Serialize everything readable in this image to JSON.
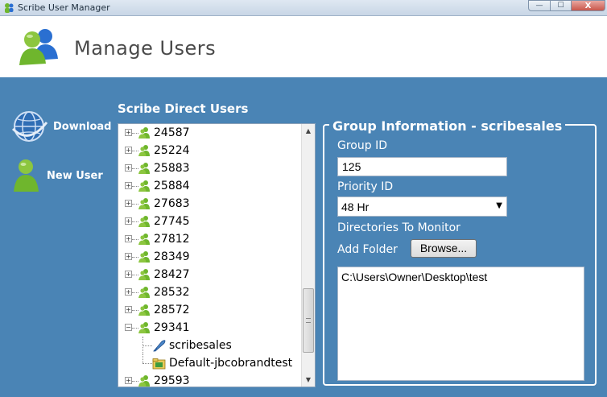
{
  "window": {
    "title": "Scribe User Manager",
    "controls": {
      "minimize": "—",
      "maximize": "☐",
      "close": "X"
    }
  },
  "header": {
    "title": "Manage Users"
  },
  "sidebar": {
    "download_label": "Download",
    "new_user_label": "New User"
  },
  "tree": {
    "heading": "Scribe Direct Users",
    "nodes": [
      {
        "label": "24587",
        "expander": "+"
      },
      {
        "label": "25224",
        "expander": "+"
      },
      {
        "label": "25883",
        "expander": "+"
      },
      {
        "label": "25884",
        "expander": "+"
      },
      {
        "label": "27683",
        "expander": "+"
      },
      {
        "label": "27745",
        "expander": "+"
      },
      {
        "label": "27812",
        "expander": "+"
      },
      {
        "label": "28349",
        "expander": "+"
      },
      {
        "label": "28427",
        "expander": "+"
      },
      {
        "label": "28532",
        "expander": "+"
      },
      {
        "label": "28572",
        "expander": "+"
      },
      {
        "label": "29341",
        "expander": "−"
      },
      {
        "label": "scribesales",
        "child": true,
        "icon": "quill-icon"
      },
      {
        "label": "Default-jbcobrandtest",
        "child": true,
        "icon": "folder-icon"
      },
      {
        "label": "29593",
        "expander": "+"
      }
    ],
    "scroll_up": "▲",
    "scroll_down": "▼"
  },
  "group": {
    "legend": "Group Information - scribesales",
    "group_id_label": "Group ID",
    "group_id_value": "125",
    "priority_label": "Priority ID",
    "priority_value": "48 Hr",
    "priority_arrow": "▼",
    "dirs_label": "Directories To Monitor",
    "add_folder_label": "Add Folder",
    "browse_label": "Browse...",
    "folders": [
      "C:\\Users\\Owner\\Desktop\\test"
    ]
  },
  "colors": {
    "background_blue": "#4a84b5",
    "user_icon_green": "#6fb62d",
    "user_icon_blue": "#2a6fd1"
  }
}
